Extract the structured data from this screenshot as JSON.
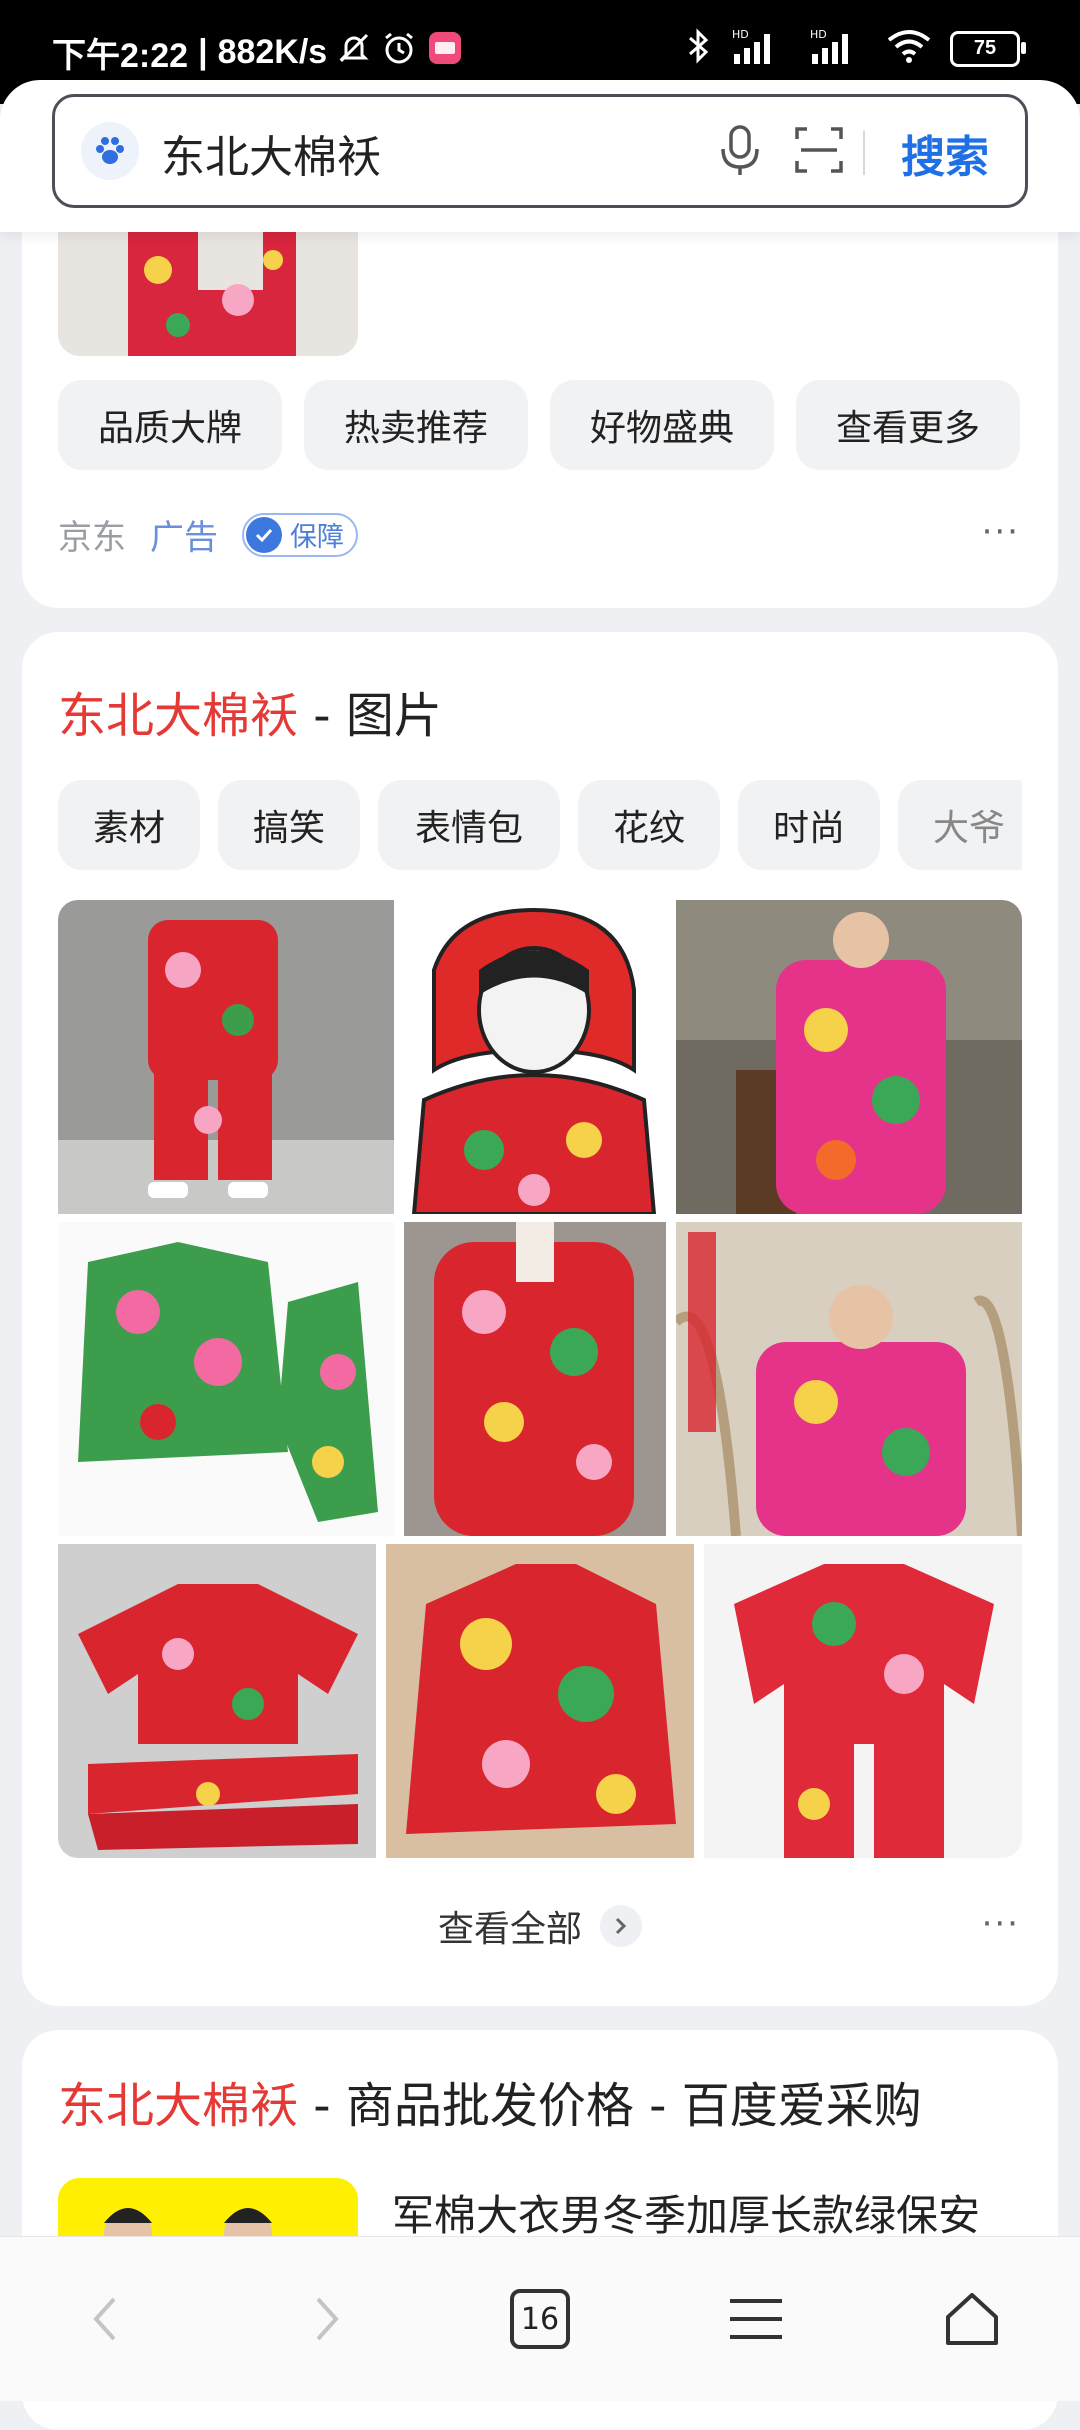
{
  "status_bar": {
    "time": "下午2:22",
    "speed": "882K/s",
    "battery": "75",
    "signal_label_1": "HD",
    "signal_label_2": "HD"
  },
  "search": {
    "query": "东北大棉袄",
    "button_label": "搜索"
  },
  "ad_card": {
    "chips": [
      "品质大牌",
      "热卖推荐",
      "好物盛典",
      "查看更多"
    ],
    "source": "京东",
    "ad_label": "广告",
    "guarantee_label": "保障",
    "more": "···"
  },
  "image_card": {
    "title_highlight": "东北大棉袄",
    "title_rest": " - 图片",
    "chips": [
      "素材",
      "搞笑",
      "表情包",
      "花纹",
      "时尚",
      "大爷"
    ],
    "view_all": "查看全部",
    "more": "···"
  },
  "product_card": {
    "title_highlight": "东北大棉袄",
    "title_rest": " - 商品批发价格 - 百度爱采购",
    "item_title": "军棉大衣男冬季加厚长款绿保安"
  },
  "bottom_nav": {
    "tab_count": "16"
  },
  "colors": {
    "accent_blue": "#1f6fe5",
    "highlight_red": "#e53935",
    "page_bg": "#eef0f4"
  }
}
